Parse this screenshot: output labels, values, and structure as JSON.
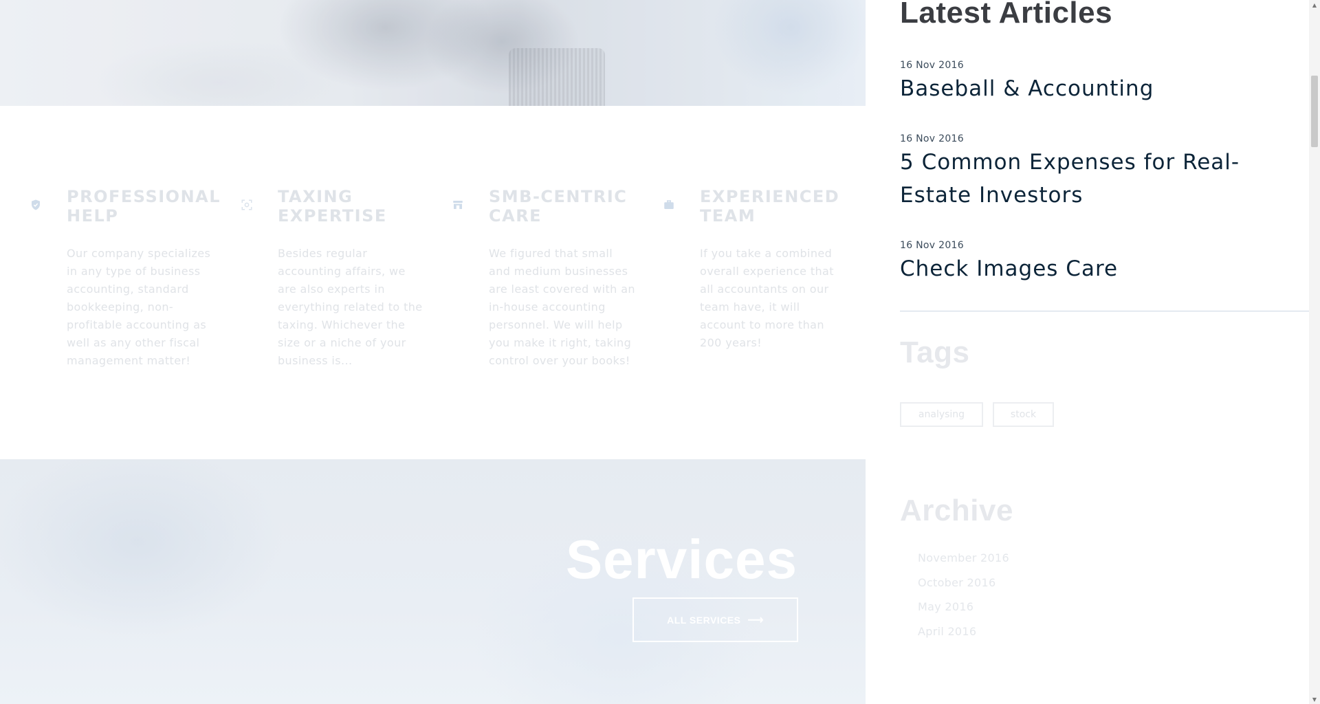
{
  "features": [
    {
      "title": "PROFESSIONAL HELP",
      "text": "Our company specializes in any type of business accounting, standard bookkeeping, non-profitable accounting as well as any other fiscal management matter!",
      "icon": "shield-check-icon"
    },
    {
      "title": "TAXING EXPERTISE",
      "text": "Besides regular accounting affairs, we are also experts in everything related to the taxing. Whichever the size or a niche of your business is...",
      "icon": "focus-icon"
    },
    {
      "title": "SMB-CENTRIC CARE",
      "text": "We figured that small and medium businesses are least covered with an in-house accounting personnel. We will help you make it right, taking control over your books!",
      "icon": "store-icon"
    },
    {
      "title": "EXPERIENCED TEAM",
      "text": "If you take a combined overall experience that all accountants on our team have, it will account to more than 200 years!",
      "icon": "briefcase-icon"
    }
  ],
  "services": {
    "title": "Services",
    "button_label": "ALL SERVICES",
    "button_icon": "arrow-right-icon"
  },
  "sidebar": {
    "latest_title": "Latest Articles",
    "articles": [
      {
        "date": "16 Nov 2016",
        "title": "Baseball & Accounting"
      },
      {
        "date": "16 Nov 2016",
        "title": "5 Common Expenses for Real-Estate Investors"
      },
      {
        "date": "16 Nov 2016",
        "title": "Check Images Care"
      }
    ],
    "tags_title": "Tags",
    "tags": [
      "analysing",
      "stock"
    ],
    "archive_title": "Archive",
    "archive": [
      "November 2016",
      "October 2016",
      "May 2016",
      "April 2016"
    ]
  },
  "colors": {
    "heading_dark": "#0c2438",
    "faded_text": "#e0e3e7",
    "icon_blue": "#cfdcea",
    "divider": "#cdd8e4"
  }
}
